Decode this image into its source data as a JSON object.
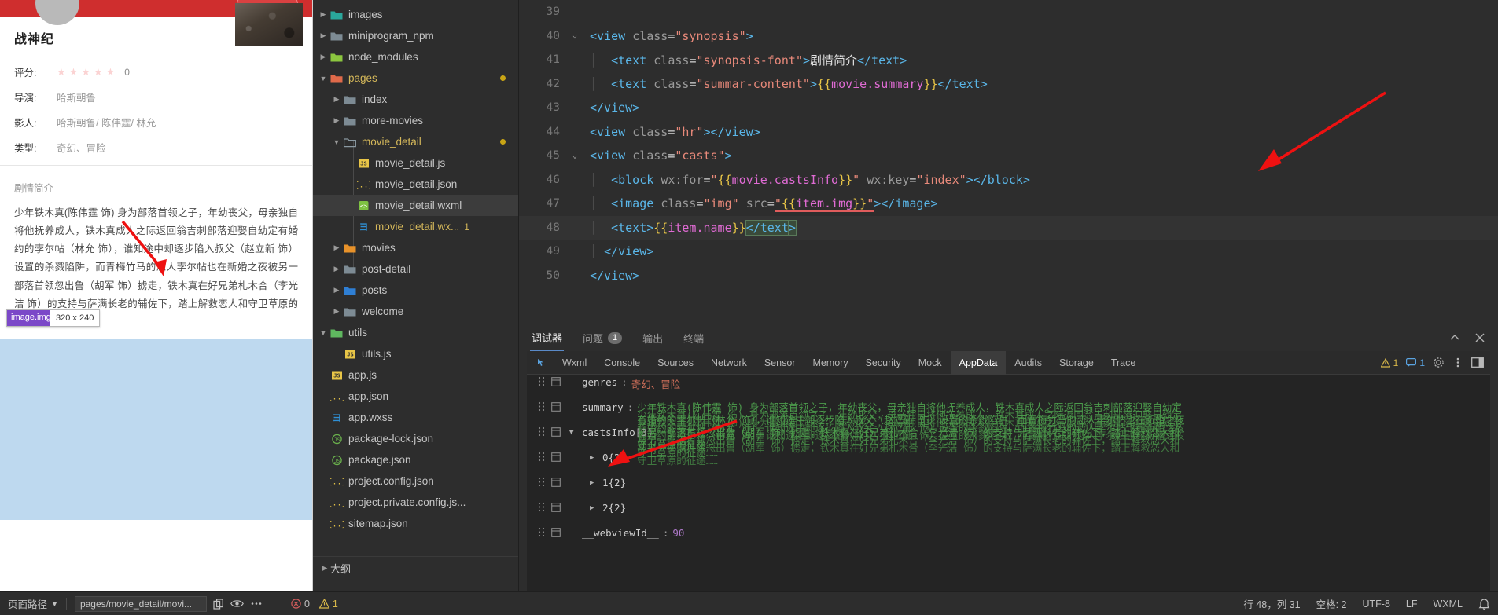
{
  "simulator": {
    "movie_title": "战神纪",
    "rating_label": "评分:",
    "rating_value": "0",
    "stars": [
      "★",
      "★",
      "★",
      "★",
      "★"
    ],
    "director_label": "导演:",
    "director_value": "哈斯朝鲁",
    "casts_label": "影人:",
    "casts_value": "哈斯朝鲁/ 陈伟霆/ 林允",
    "genre_label": "类型:",
    "genre_value": "奇幻、冒险",
    "synopsis_title": "剧情简介",
    "summary": "少年铁木真(陈伟霆 饰) 身为部落首领之子，年幼丧父，母亲独自将他抚养成人，铁木真成人之际返回翁吉刺部落迎娶自幼定有婚约的孛尔帖（林允 饰），谁知途中却逐步陷入叔父（赵立新 饰）设置的杀戮陷阱，而青梅竹马的恋人孛尔帖也在新婚之夜被另一部落首领忽出鲁（胡军 饰）掳走，铁木真在好兄弟札木合（李光洁 饰）的支持与萨满长老的辅佐下，踏上解救恋人和守卫草原的征途……",
    "image_tooltip_name": "image.img",
    "image_tooltip_dims": "320 x 240"
  },
  "filetree": {
    "items": [
      {
        "label": "images",
        "icon": "folder-images-icon",
        "depth": 1,
        "twisty": "right",
        "color": "white",
        "badge": "",
        "selected": false
      },
      {
        "label": "miniprogram_npm",
        "icon": "folder-icon",
        "depth": 1,
        "twisty": "right",
        "color": "white",
        "badge": "",
        "selected": false
      },
      {
        "label": "node_modules",
        "icon": "folder-node-icon",
        "depth": 1,
        "twisty": "right",
        "color": "white",
        "badge": "",
        "selected": false
      },
      {
        "label": "pages",
        "icon": "folder-pages-icon",
        "depth": 1,
        "twisty": "down",
        "color": "yellow",
        "badge": "dot",
        "selected": false
      },
      {
        "label": "index",
        "icon": "folder-icon",
        "depth": 2,
        "twisty": "right",
        "color": "white",
        "badge": "",
        "selected": false
      },
      {
        "label": "more-movies",
        "icon": "folder-icon",
        "depth": 2,
        "twisty": "right",
        "color": "white",
        "badge": "",
        "selected": false
      },
      {
        "label": "movie_detail",
        "icon": "folder-open-icon",
        "depth": 2,
        "twisty": "down",
        "color": "yellow",
        "badge": "dot",
        "selected": false
      },
      {
        "label": "movie_detail.js",
        "icon": "js-icon",
        "depth": 3,
        "twisty": "",
        "color": "white",
        "badge": "",
        "selected": false
      },
      {
        "label": "movie_detail.json",
        "icon": "json-icon",
        "depth": 3,
        "twisty": "",
        "color": "white",
        "badge": "",
        "selected": false
      },
      {
        "label": "movie_detail.wxml",
        "icon": "wxml-icon",
        "depth": 3,
        "twisty": "",
        "color": "white",
        "badge": "",
        "selected": true
      },
      {
        "label": "movie_detail.wx...",
        "icon": "wxss-icon",
        "depth": 3,
        "twisty": "",
        "color": "yellow",
        "badge": "1",
        "selected": false
      },
      {
        "label": "movies",
        "icon": "folder-movies-icon",
        "depth": 2,
        "twisty": "right",
        "color": "white",
        "badge": "",
        "selected": false
      },
      {
        "label": "post-detail",
        "icon": "folder-icon",
        "depth": 2,
        "twisty": "right",
        "color": "white",
        "badge": "",
        "selected": false
      },
      {
        "label": "posts",
        "icon": "folder-posts-icon",
        "depth": 2,
        "twisty": "right",
        "color": "white",
        "badge": "",
        "selected": false
      },
      {
        "label": "welcome",
        "icon": "folder-icon",
        "depth": 2,
        "twisty": "right",
        "color": "white",
        "badge": "",
        "selected": false
      },
      {
        "label": "utils",
        "icon": "folder-utils-icon",
        "depth": 1,
        "twisty": "down",
        "color": "white",
        "badge": "",
        "selected": false
      },
      {
        "label": "utils.js",
        "icon": "js-icon",
        "depth": 2,
        "twisty": "",
        "color": "white",
        "badge": "",
        "selected": false
      },
      {
        "label": "app.js",
        "icon": "js-icon",
        "depth": 1,
        "twisty": "",
        "color": "white",
        "badge": "",
        "selected": false
      },
      {
        "label": "app.json",
        "icon": "json-icon",
        "depth": 1,
        "twisty": "",
        "color": "white",
        "badge": "",
        "selected": false
      },
      {
        "label": "app.wxss",
        "icon": "wxss-icon",
        "depth": 1,
        "twisty": "",
        "color": "white",
        "badge": "",
        "selected": false
      },
      {
        "label": "package-lock.json",
        "icon": "node-icon",
        "depth": 1,
        "twisty": "",
        "color": "white",
        "badge": "",
        "selected": false
      },
      {
        "label": "package.json",
        "icon": "node-icon",
        "depth": 1,
        "twisty": "",
        "color": "white",
        "badge": "",
        "selected": false
      },
      {
        "label": "project.config.json",
        "icon": "json-icon",
        "depth": 1,
        "twisty": "",
        "color": "white",
        "badge": "",
        "selected": false
      },
      {
        "label": "project.private.config.js...",
        "icon": "json-icon",
        "depth": 1,
        "twisty": "",
        "color": "white",
        "badge": "",
        "selected": false
      },
      {
        "label": "sitemap.json",
        "icon": "json-icon",
        "depth": 1,
        "twisty": "",
        "color": "white",
        "badge": "",
        "selected": false
      }
    ],
    "outline_label": "大纲"
  },
  "editor": {
    "lines": [
      {
        "num": "39",
        "fold": "",
        "active": false
      },
      {
        "num": "40",
        "fold": "down",
        "active": false
      },
      {
        "num": "41",
        "fold": "",
        "active": false
      },
      {
        "num": "42",
        "fold": "",
        "active": false
      },
      {
        "num": "43",
        "fold": "",
        "active": false
      },
      {
        "num": "44",
        "fold": "",
        "active": false
      },
      {
        "num": "45",
        "fold": "down",
        "active": false
      },
      {
        "num": "46",
        "fold": "",
        "active": false
      },
      {
        "num": "47",
        "fold": "",
        "active": false
      },
      {
        "num": "48",
        "fold": "",
        "active": true
      },
      {
        "num": "49",
        "fold": "",
        "active": false
      },
      {
        "num": "50",
        "fold": "",
        "active": false
      }
    ],
    "code": {
      "l40": "<view class=\"synopsis\">",
      "l41": "<text class=\"synopsis-font\">剧情简介</text>",
      "l42": "<text class=\"summar-content\">{{movie.summary}}</text>",
      "l43": "</view>",
      "l44": "<view class=\"hr\"></view>",
      "l45": "<view class=\"casts\">",
      "l46": "<block wx:for=\"{{movie.castsInfo}}\" wx:key=\"index\"></block>",
      "l47": "<image class=\"img\" src=\"{{item.img}}\"></image>",
      "l48": "<text>{{item.name}}</text>",
      "l49": "</view>",
      "l50": "</view>"
    }
  },
  "debugger": {
    "tabs": [
      {
        "label": "调试器",
        "active": true,
        "badge": ""
      },
      {
        "label": "问题",
        "active": false,
        "badge": "1"
      },
      {
        "label": "输出",
        "active": false,
        "badge": ""
      },
      {
        "label": "终端",
        "active": false,
        "badge": ""
      }
    ],
    "collapse_icon": "chevron-up-icon",
    "close_icon": "close-icon"
  },
  "devtools": {
    "inspect_icon": "inspect-element-icon",
    "tabs": [
      {
        "label": "Wxml",
        "active": false
      },
      {
        "label": "Console",
        "active": false
      },
      {
        "label": "Sources",
        "active": false
      },
      {
        "label": "Network",
        "active": false
      },
      {
        "label": "Sensor",
        "active": false
      },
      {
        "label": "Memory",
        "active": false
      },
      {
        "label": "Security",
        "active": false
      },
      {
        "label": "Mock",
        "active": false
      },
      {
        "label": "AppData",
        "active": true
      },
      {
        "label": "Audits",
        "active": false
      },
      {
        "label": "Storage",
        "active": false
      },
      {
        "label": "Trace",
        "active": false
      }
    ],
    "warn_count": "1",
    "info_count": "1",
    "settings_icon": "gear-icon",
    "more_icon": "kebab-menu-icon",
    "dock_icon": "dock-panel-icon"
  },
  "appdata": {
    "rows": [
      {
        "key": "genres",
        "sep": ":",
        "value": "奇幻、冒险",
        "type": "string",
        "arrow": "",
        "indent": 0
      },
      {
        "key": "summary",
        "sep": ":",
        "value": "",
        "type": "multiline",
        "arrow": "",
        "indent": 0
      },
      {
        "key": "castsInfo",
        "sep": "",
        "value": "[3]",
        "type": "count",
        "arrow": "down",
        "indent": 0
      },
      {
        "key": "0",
        "sep": "",
        "value": "{2}",
        "type": "obj",
        "arrow": "right",
        "indent": 1
      },
      {
        "key": "1",
        "sep": "",
        "value": "{2}",
        "type": "obj",
        "arrow": "right",
        "indent": 1
      },
      {
        "key": "2",
        "sep": "",
        "value": "{2}",
        "type": "obj",
        "arrow": "right",
        "indent": 1
      },
      {
        "key": "__webviewId__",
        "sep": ":",
        "value": "90",
        "type": "number",
        "arrow": "",
        "indent": 0
      }
    ],
    "summary_text": "少年铁木真(陈伟霆 饰) 身为部落首领之子，年幼丧父，母亲独自将他抚养成人，铁木真成人之际返回翁吉刺部落迎娶自幼定有婚约的孛尔帖（林允 饰），谁知途中却逐步陷入叔父（赵立新 饰）设置的杀戮陷阱，而青梅竹马的恋人孛尔帖也在新婚之夜被另一部落首领忽出鲁（胡军 饰）掳走，铁木真在好兄弟札木合（李光洁 饰）的支持与萨满长老的辅佐下，踏上解救恋人和守卫草原的征途……"
  },
  "statusbar": {
    "page_path_label": "页面路径",
    "page_path_value": "pages/movie_detail/movi...",
    "copy_icon": "copy-icon",
    "eye_icon": "eye-icon",
    "more_icon": "ellipsis-icon",
    "error_count": "0",
    "warn_count": "1",
    "line_col": "行 48，列 31",
    "spaces": "空格: 2",
    "encoding": "UTF-8",
    "eol": "LF",
    "language": "WXML",
    "bell_icon": "bell-icon"
  },
  "colors": {
    "accent_red": "#cf2e2e",
    "editor_bg": "#2d2d2d",
    "panel_bg": "#242424",
    "selection_blue": "#bed9ef",
    "tag_blue": "#5ab6e8",
    "string_red": "#e8897a",
    "brace_yellow": "#e8c547",
    "mustache_pink": "#e06bd4",
    "folder_yellow": "#d5b85a"
  }
}
